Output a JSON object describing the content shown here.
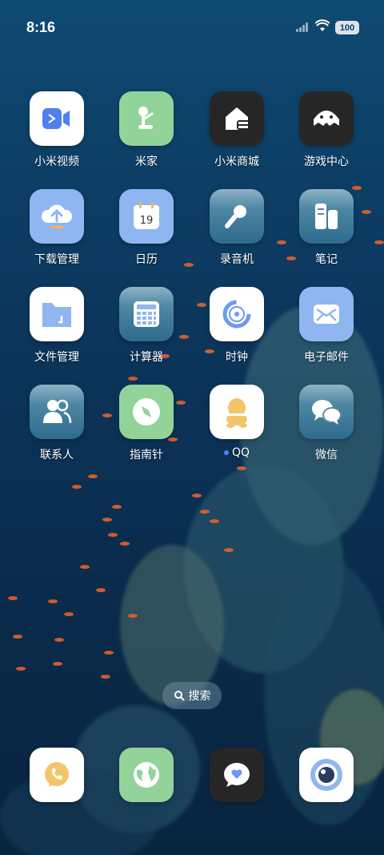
{
  "status_bar": {
    "time": "8:16",
    "battery": "100"
  },
  "apps": [
    {
      "label": "小米视频",
      "icon": "video-icon"
    },
    {
      "label": "米家",
      "icon": "home-lamp-icon"
    },
    {
      "label": "小米商城",
      "icon": "shop-icon"
    },
    {
      "label": "游戏中心",
      "icon": "game-center-icon"
    },
    {
      "label": "下载管理",
      "icon": "download-cloud-icon"
    },
    {
      "label": "日历",
      "icon": "calendar-icon",
      "day": "19"
    },
    {
      "label": "录音机",
      "icon": "microphone-icon"
    },
    {
      "label": "笔记",
      "icon": "notes-icon"
    },
    {
      "label": "文件管理",
      "icon": "folder-icon"
    },
    {
      "label": "计算器",
      "icon": "calculator-icon"
    },
    {
      "label": "时钟",
      "icon": "clock-icon"
    },
    {
      "label": "电子邮件",
      "icon": "mail-icon"
    },
    {
      "label": "联系人",
      "icon": "contacts-icon"
    },
    {
      "label": "指南针",
      "icon": "compass-icon"
    },
    {
      "label": "QQ",
      "icon": "qq-penguin-icon"
    },
    {
      "label": "微信",
      "icon": "wechat-icon"
    }
  ],
  "search": {
    "label": "搜索"
  },
  "dock": [
    {
      "icon": "phone-icon"
    },
    {
      "icon": "browser-globe-icon"
    },
    {
      "icon": "messages-icon"
    },
    {
      "icon": "camera-icon"
    }
  ]
}
